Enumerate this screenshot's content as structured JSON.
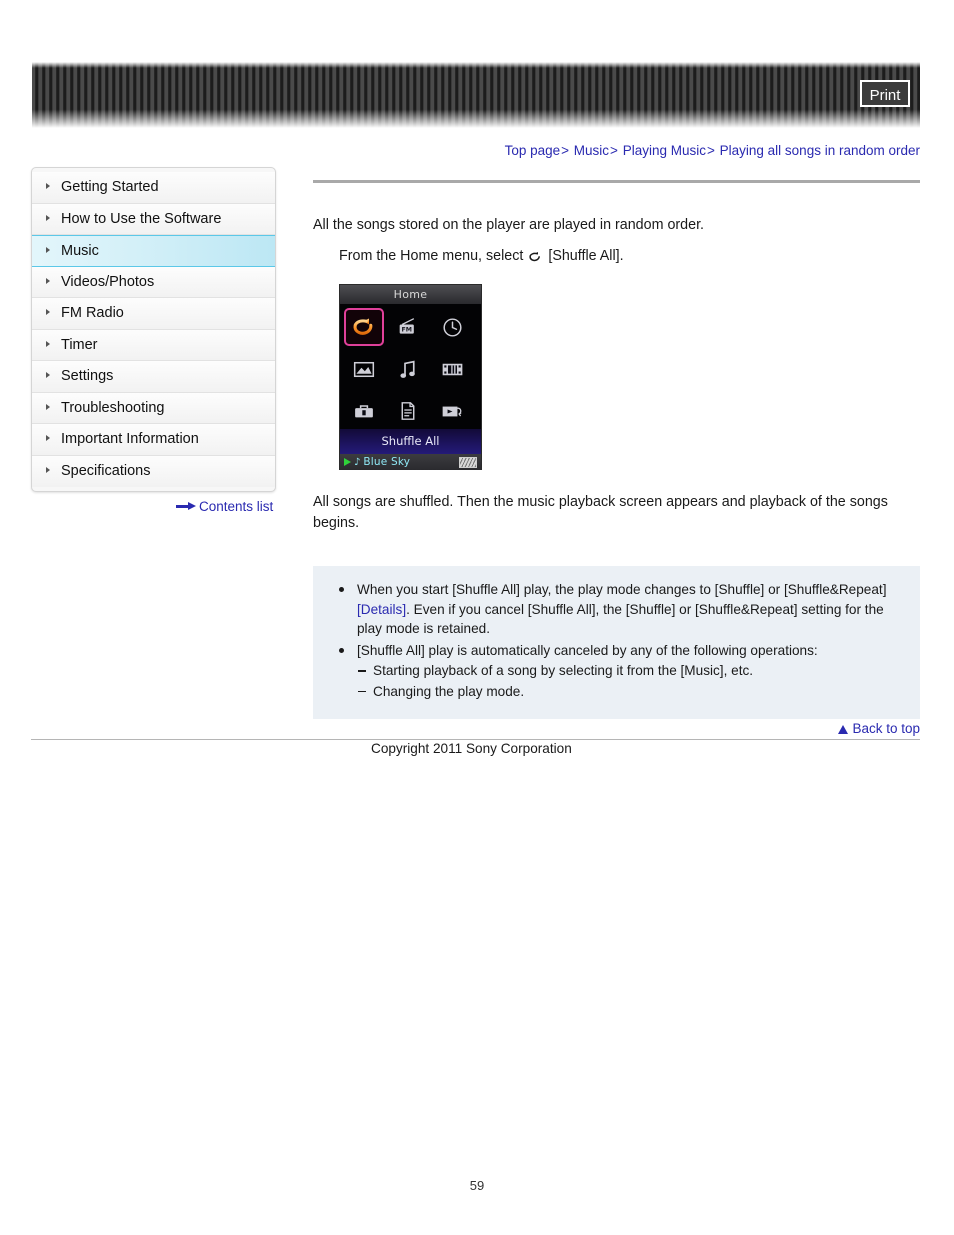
{
  "header": {
    "print_label": "Print"
  },
  "breadcrumb": {
    "items": [
      "Top page",
      "Music",
      "Playing Music",
      "Playing all songs in random order"
    ],
    "separator": ">"
  },
  "sidebar": {
    "items": [
      {
        "label": "Getting Started",
        "active": false
      },
      {
        "label": "How to Use the Software",
        "active": false
      },
      {
        "label": "Music",
        "active": true
      },
      {
        "label": "Videos/Photos",
        "active": false
      },
      {
        "label": "FM Radio",
        "active": false
      },
      {
        "label": "Timer",
        "active": false
      },
      {
        "label": "Settings",
        "active": false
      },
      {
        "label": "Troubleshooting",
        "active": false
      },
      {
        "label": "Important Information",
        "active": false
      },
      {
        "label": "Specifications",
        "active": false
      }
    ],
    "contents_link": "Contents list"
  },
  "main": {
    "intro": "All the songs stored on the player are played in random order.",
    "step_prefix": "From the Home menu, select",
    "step_suffix": "[Shuffle All].",
    "result": "All songs are shuffled. Then the music playback screen appears and playback of the songs begins."
  },
  "device": {
    "title": "Home",
    "selected_label": "Shuffle All",
    "icons": [
      "shuffle-icon",
      "fm-radio-icon",
      "clock-icon",
      "photo-icon",
      "music-note-icon",
      "video-icon",
      "toolbox-icon",
      "document-icon",
      "playlist-icon"
    ],
    "status": {
      "play_state": "playing",
      "track": "Blue Sky",
      "battery": "full"
    }
  },
  "notes": {
    "bullet1_part1": "When you start [Shuffle All] play, the play mode changes to [Shuffle] or [Shuffle&Repeat] ",
    "bullet1_link": "[Details]",
    "bullet1_part2": ". Even if you cancel [Shuffle All], the [Shuffle] or [Shuffle&Repeat] setting for the play mode is retained.",
    "bullet2": "[Shuffle All] play is automatically canceled by any of the following operations:",
    "sub1": "Starting playback of a song by selecting it from the [Music], etc.",
    "sub2": "Changing the play mode."
  },
  "footer": {
    "back_to_top": "Back to top",
    "copyright": "Copyright 2011 Sony Corporation",
    "page_number": "59"
  },
  "colors": {
    "link": "#2a2ab0",
    "active_nav": "#bce7f4",
    "note_bg": "#ebf0f5",
    "selection_border": "#e0409a",
    "shuffle_orange": "#ff9a2e"
  }
}
